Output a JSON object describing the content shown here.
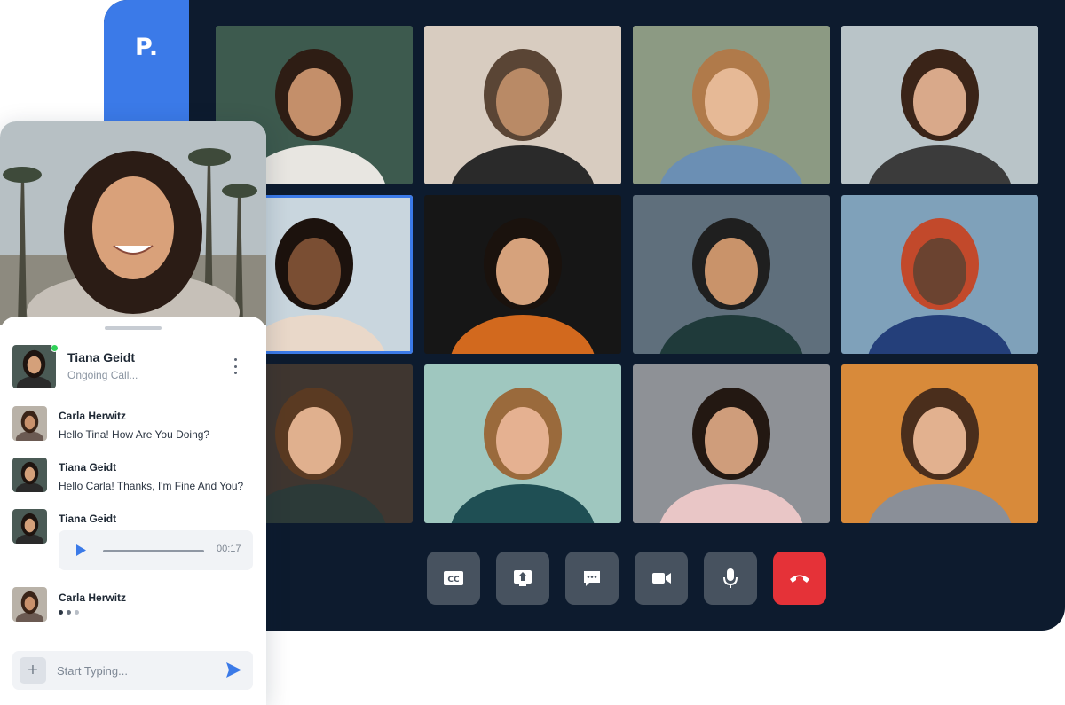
{
  "brand": {
    "logo_text": "P."
  },
  "participants": [
    {
      "name": "participant-1",
      "bg": "#3d5a4e",
      "skin": "#c48f6a",
      "hair": "#2e1d14",
      "shirt": "#e8e6e1"
    },
    {
      "name": "participant-2",
      "bg": "#d8ccc0",
      "skin": "#b98a66",
      "hair": "#5a4535",
      "shirt": "#2a2a2a"
    },
    {
      "name": "participant-3",
      "bg": "#8c9a83",
      "skin": "#e6b996",
      "hair": "#b07a4a",
      "shirt": "#6b8fb4"
    },
    {
      "name": "participant-4",
      "bg": "#b9c4c8",
      "skin": "#d9a98a",
      "hair": "#3a2418",
      "shirt": "#3b3b3b"
    },
    {
      "name": "participant-5",
      "bg": "#c9d6de",
      "skin": "#7a4e33",
      "hair": "#1c120d",
      "shirt": "#e9d8c9"
    },
    {
      "name": "participant-6",
      "bg": "#161616",
      "skin": "#d6a27c",
      "hair": "#1a120d",
      "shirt": "#d2691e"
    },
    {
      "name": "participant-7",
      "bg": "#5f6f7c",
      "skin": "#c9936a",
      "hair": "#1f1f1f",
      "shirt": "#1f3a3a"
    },
    {
      "name": "participant-8",
      "bg": "#7fa1ba",
      "skin": "#6b4330",
      "hair": "#c2492b",
      "shirt": "#243f7a"
    },
    {
      "name": "participant-9",
      "bg": "#3f3630",
      "skin": "#e0b08e",
      "hair": "#5a3a22",
      "shirt": "#2c3a38"
    },
    {
      "name": "participant-10",
      "bg": "#9fc7bf",
      "skin": "#e5b191",
      "hair": "#9a6a3c",
      "shirt": "#1f4f54"
    },
    {
      "name": "participant-11",
      "bg": "#8e9196",
      "skin": "#cf9d7b",
      "hair": "#231812",
      "shirt": "#e9c6c6"
    },
    {
      "name": "participant-12",
      "bg": "#d88a3a",
      "skin": "#e2b18f",
      "hair": "#4a2e1c",
      "shirt": "#8a8f98"
    }
  ],
  "active_participant_index": 4,
  "controls": [
    {
      "id": "captions",
      "icon": "closed-captions-icon"
    },
    {
      "id": "share-screen",
      "icon": "share-screen-icon"
    },
    {
      "id": "chat",
      "icon": "chat-bubble-icon"
    },
    {
      "id": "camera",
      "icon": "video-camera-icon"
    },
    {
      "id": "microphone",
      "icon": "microphone-icon"
    },
    {
      "id": "end-call",
      "icon": "phone-hangup-icon"
    }
  ],
  "colors": {
    "accent": "#3b7ae8",
    "end_call": "#e53238",
    "online": "#30d158",
    "dark_bg": "#0d1b2e"
  },
  "chat": {
    "header": {
      "name": "Tiana Geidt",
      "status": "Ongoing Call..."
    },
    "messages": [
      {
        "author": "Carla Herwitz",
        "text": "Hello Tina! How Are You Doing?"
      },
      {
        "author": "Tiana Geidt",
        "text": "Hello Carla! Thanks, I'm Fine And You?"
      },
      {
        "author": "Tiana Geidt",
        "voice_duration": "00:17"
      },
      {
        "author": "Carla Herwitz",
        "typing": true
      }
    ],
    "composer": {
      "placeholder": "Start Typing..."
    }
  }
}
